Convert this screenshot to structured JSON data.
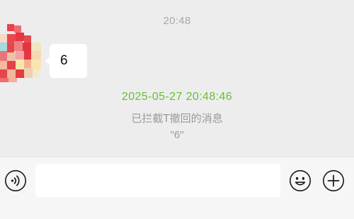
{
  "chat": {
    "timestamp": "20:48",
    "incoming_message": "6",
    "recall_notice": {
      "time": "2025-05-27 20:48:46",
      "text": "已拦截T撤回的消息",
      "content": "\"6\""
    }
  },
  "input_bar": {
    "voice_icon": "voice-icon",
    "input_value": "",
    "emoji_icon": "emoji-icon",
    "plus_icon": "plus-icon"
  },
  "colors": {
    "background": "#ededed",
    "bubble": "#ffffff",
    "notice_time": "#6abe39",
    "muted_text": "#9a9a9a"
  }
}
